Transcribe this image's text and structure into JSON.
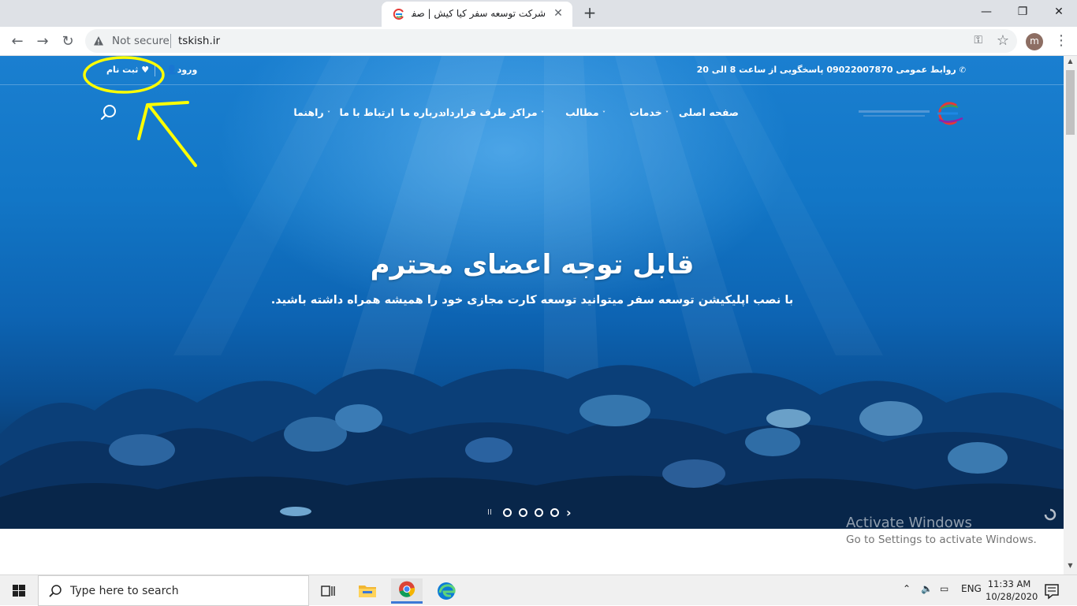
{
  "browser": {
    "tab_title": "شرکت توسعه سفر کیا کیش | صفحه",
    "tab_close": "✕",
    "new_tab": "+",
    "minimize": "—",
    "restore": "❐",
    "close": "✕",
    "back": "←",
    "forward": "→",
    "reload": "↻",
    "security_label": "Not secure",
    "url": "tskish.ir",
    "profile_initial": "m",
    "menu": "⋮"
  },
  "site": {
    "topbar": {
      "phone_text": "روابط عمومی 09022007870 پاسخگویی از ساعت 8 الی 20",
      "login_label": "ورود",
      "register_label": "ثبت نام"
    },
    "nav": {
      "items": [
        {
          "label": "صفحه اصلی",
          "has_dropdown": false
        },
        {
          "label": "خدمات",
          "has_dropdown": true
        },
        {
          "label": "مطالب",
          "has_dropdown": true
        },
        {
          "label": "مراکز طرف قرارداد",
          "has_dropdown": true
        },
        {
          "label": "درباره ما",
          "has_dropdown": false
        },
        {
          "label": "ارتباط با ما",
          "has_dropdown": false
        },
        {
          "label": "راهنما",
          "has_dropdown": true
        }
      ],
      "chevron": "˅"
    },
    "hero": {
      "title": "قابل توجه اعضای محترم",
      "subtitle": "با نصب اپلیکیشن توسعه سفر میتوانید توسعه کارت مجازی خود را همیشه همراه داشته باشید."
    },
    "slider": {
      "pause": "II",
      "next": "›",
      "slide_count": 4
    }
  },
  "watermark": {
    "line1": "Activate Windows",
    "line2": "Go to Settings to activate Windows."
  },
  "taskbar": {
    "search_placeholder": "Type here to search",
    "language": "ENG",
    "time": "11:33 AM",
    "date": "10/28/2020"
  },
  "colors": {
    "annotation": "#ffff00",
    "accent": "#3b78d6"
  }
}
